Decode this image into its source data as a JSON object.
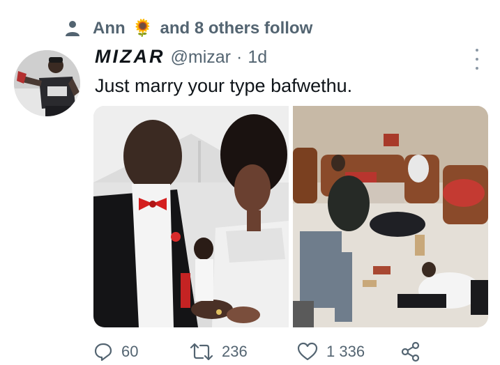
{
  "social_context": {
    "name": "Ann",
    "emoji": "🌻",
    "text": "and 8 others follow",
    "icon": "person-icon"
  },
  "author": {
    "display_name": "MIZAR",
    "handle": "@mizar",
    "separator": "·",
    "time": "1d"
  },
  "tweet": {
    "text": "Just marry your type bafwethu."
  },
  "media": {
    "photos": [
      {
        "name": "wedding-ring-photo"
      },
      {
        "name": "after-party-photo"
      }
    ]
  },
  "actions": {
    "reply_count": "60",
    "retweet_count": "236",
    "like_count": "1 336",
    "icons": [
      "reply-icon",
      "retweet-icon",
      "like-icon",
      "share-icon"
    ]
  },
  "colors": {
    "text_primary": "#0f1419",
    "text_secondary": "#536471",
    "background": "#ffffff"
  }
}
